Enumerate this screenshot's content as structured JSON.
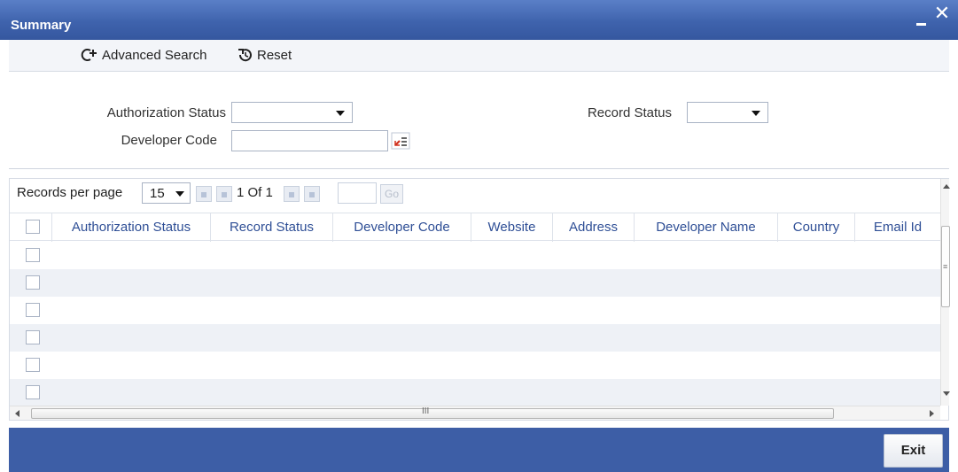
{
  "window": {
    "title": "Summary"
  },
  "toolbar": {
    "advanced_search": "Advanced Search",
    "reset": "Reset"
  },
  "criteria": {
    "authorization_status_label": "Authorization Status",
    "authorization_status_value": "",
    "record_status_label": "Record Status",
    "record_status_value": "",
    "developer_code_label": "Developer Code",
    "developer_code_value": ""
  },
  "pager": {
    "records_per_page_label": "Records per page",
    "per_page_value": "15",
    "page_info": "1 Of 1",
    "go_label": "Go"
  },
  "grid": {
    "columns": [
      "Authorization Status",
      "Record Status",
      "Developer Code",
      "Website",
      "Address",
      "Developer Name",
      "Country",
      "Email Id"
    ],
    "row_count": 6
  },
  "footer": {
    "exit_label": "Exit"
  },
  "colors": {
    "titlebar": "#3f63ad",
    "footer": "#3d5ea6",
    "header_text": "#2f4f96",
    "row_alt": "#eef1f6"
  }
}
